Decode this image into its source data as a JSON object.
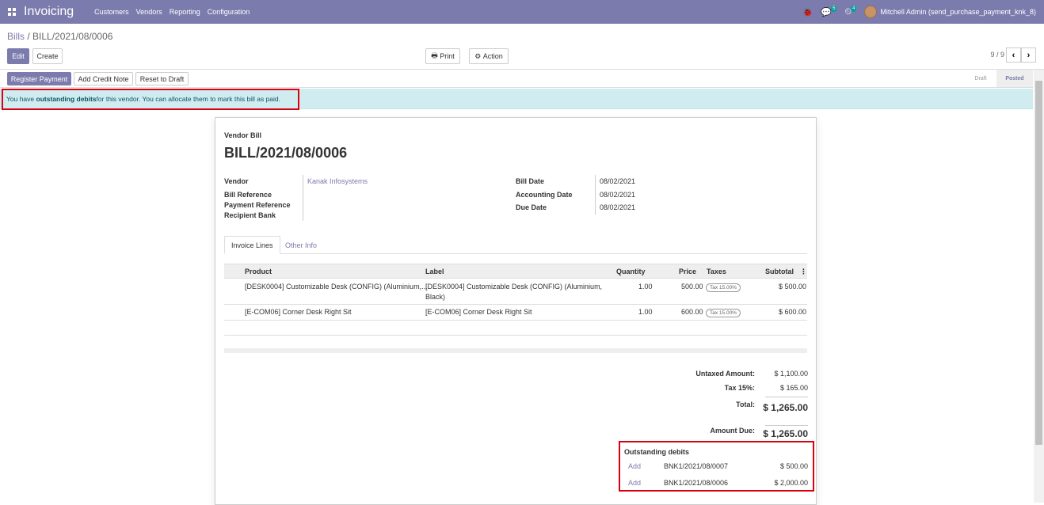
{
  "topbar": {
    "app_name": "Invoicing",
    "menu": [
      "Customers",
      "Vendors",
      "Reporting",
      "Configuration"
    ],
    "chat_count": "5",
    "activity_count": "4",
    "user": "Mitchell Admin (send_purchase_payment_knk_8)"
  },
  "control": {
    "breadcrumb_parent": "Bills",
    "breadcrumb_sep": " / ",
    "breadcrumb_current": "BILL/2021/08/0006",
    "edit": "Edit",
    "create": "Create",
    "print": "Print",
    "action": "Action",
    "pager": "9 / 9"
  },
  "statusbar": {
    "register_payment": "Register Payment",
    "add_credit_note": "Add Credit Note",
    "reset_to_draft": "Reset to Draft",
    "stage_draft": "Draft",
    "stage_posted": "Posted"
  },
  "alert": {
    "prefix": "You have ",
    "bold": "outstanding debits",
    "suffix": " for this vendor. You can allocate them to mark this bill as paid."
  },
  "sheet": {
    "doc_type": "Vendor Bill",
    "title": "BILL/2021/08/0006",
    "vendor_label": "Vendor",
    "vendor_value": "Kanak Infosystems",
    "bill_reference_label": "Bill Reference",
    "payment_reference_label": "Payment Reference",
    "recipient_bank_label": "Recipient Bank",
    "bill_date_label": "Bill Date",
    "bill_date_value": "08/02/2021",
    "accounting_date_label": "Accounting Date",
    "accounting_date_value": "08/02/2021",
    "due_date_label": "Due Date",
    "due_date_value": "08/02/2021",
    "tabs": [
      "Invoice Lines",
      "Other Info"
    ]
  },
  "lines": {
    "headers": [
      "Product",
      "Label",
      "Quantity",
      "Price",
      "Taxes",
      "Subtotal"
    ],
    "rows": [
      {
        "product": "[DESK0004] Customizable Desk (CONFIG) (Aluminium,...",
        "label1": "[DESK0004] Customizable Desk (CONFIG) (Aluminium,",
        "label2": "Black)",
        "quantity": "1.00",
        "price": "500.00",
        "tax": "Tax 15.00%",
        "subtotal": "$ 500.00"
      },
      {
        "product": "[E-COM06] Corner Desk Right Sit",
        "label1": "[E-COM06] Corner Desk Right Sit",
        "label2": "",
        "quantity": "1.00",
        "price": "600.00",
        "tax": "Tax 15.00%",
        "subtotal": "$ 600.00"
      }
    ]
  },
  "totals": {
    "untaxed_label": "Untaxed Amount:",
    "untaxed_value": "$ 1,100.00",
    "tax_label": "Tax 15%:",
    "tax_value": "$ 165.00",
    "total_label": "Total:",
    "total_value": "$ 1,265.00",
    "amount_due_label": "Amount Due:",
    "amount_due_value": "$ 1,265.00"
  },
  "outstanding": {
    "title": "Outstanding debits",
    "items": [
      {
        "action": "Add",
        "ref": "BNK1/2021/08/0007",
        "amount": "$ 500.00"
      },
      {
        "action": "Add",
        "ref": "BNK1/2021/08/0006",
        "amount": "$ 2,000.00"
      }
    ]
  },
  "colors": {
    "brand": "#7c7bad",
    "alert_bg": "#d1ecf1",
    "highlight": "#d9000f"
  }
}
